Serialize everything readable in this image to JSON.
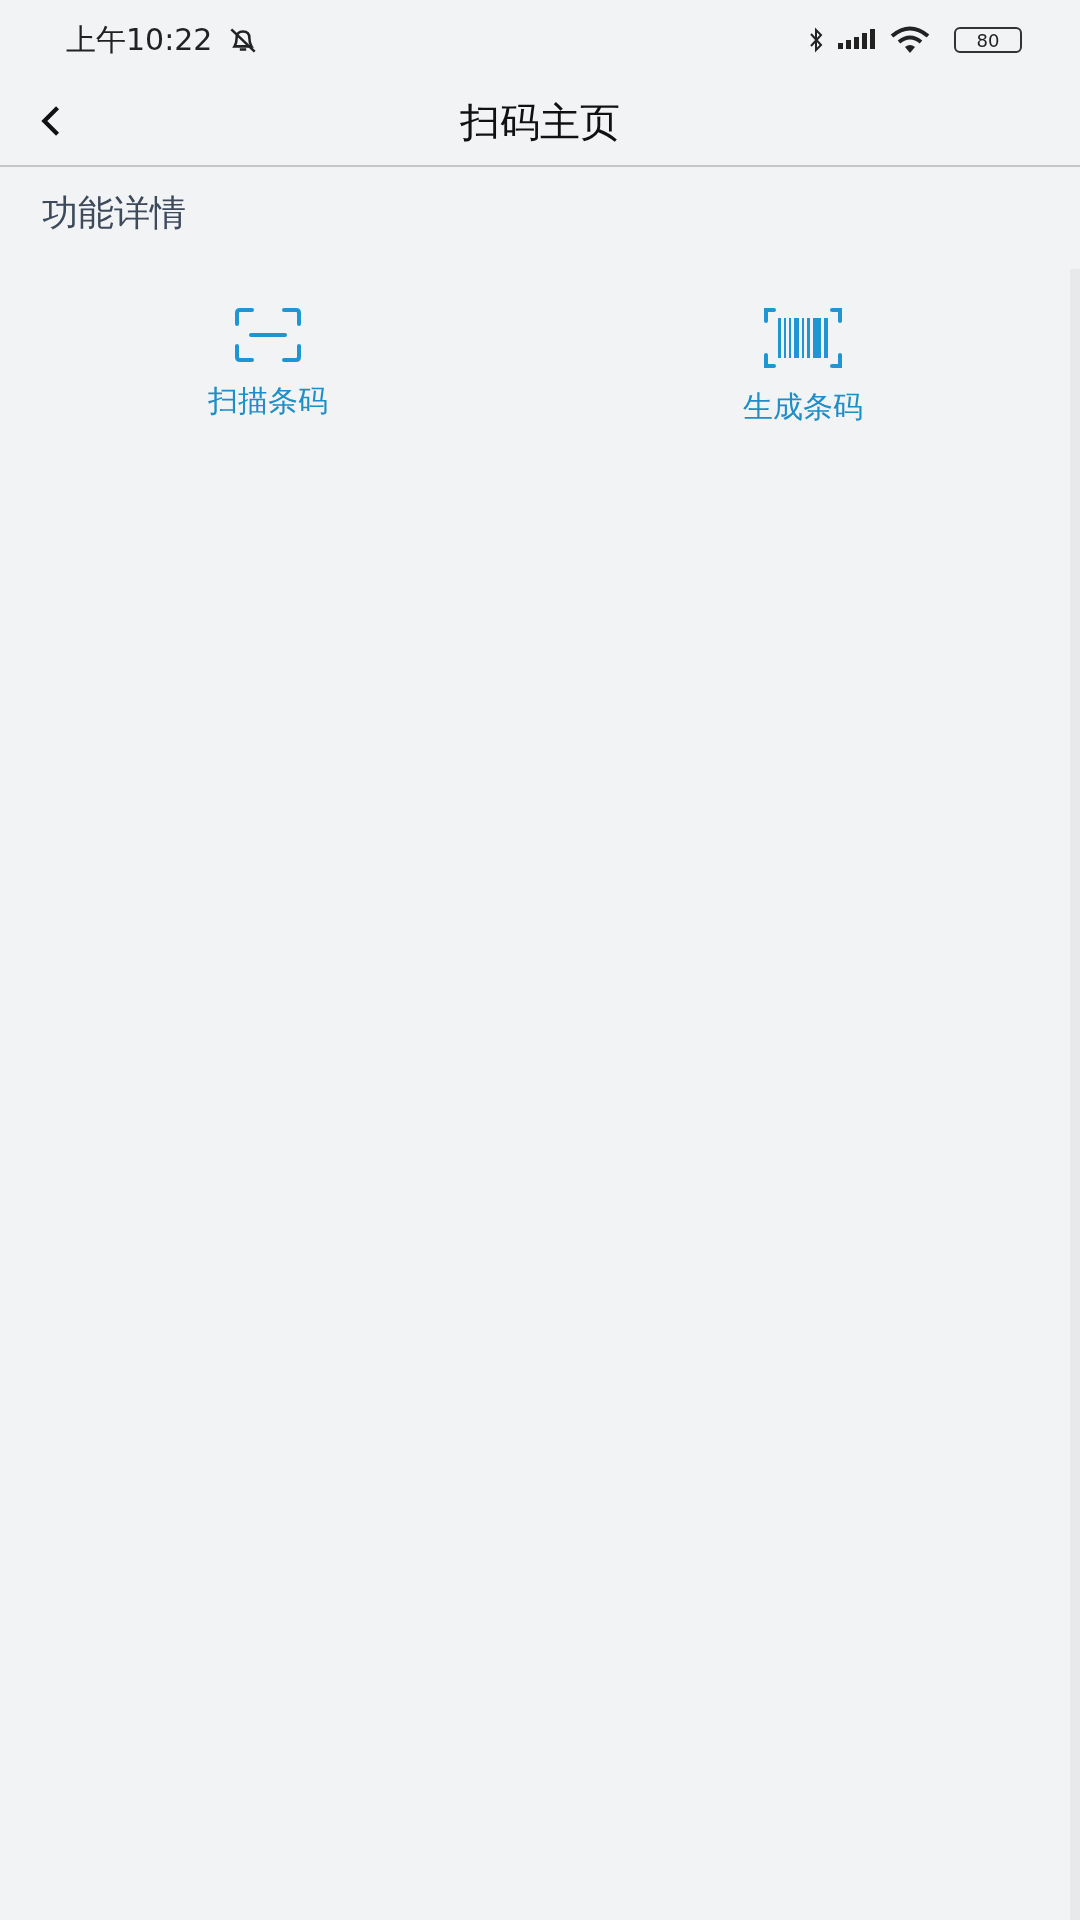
{
  "status_bar": {
    "time": "上午10:22",
    "battery": "80"
  },
  "header": {
    "title": "扫码主页"
  },
  "section": {
    "title": "功能详情"
  },
  "features": [
    {
      "kind": "scan",
      "label": "扫描条码"
    },
    {
      "kind": "barcode",
      "label": "生成条码"
    }
  ]
}
